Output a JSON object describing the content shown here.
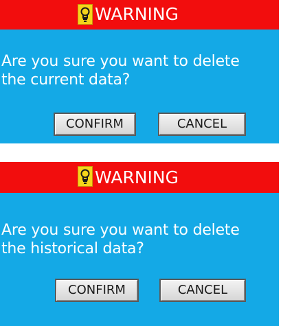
{
  "dialogs": [
    {
      "icon": "warning-bulb-icon",
      "title": "WARNING",
      "message": "Are you sure you want to delete\nthe current data?",
      "confirm_label": "CONFIRM",
      "cancel_label": "CANCEL"
    },
    {
      "icon": "warning-bulb-icon",
      "title": "WARNING",
      "message": "Are you sure you want to delete\nthe historical data?",
      "confirm_label": "CONFIRM",
      "cancel_label": "CANCEL"
    }
  ],
  "colors": {
    "title_bar": "#f20d0d",
    "dialog_background": "#14a9e6",
    "icon_background": "#f5d51a",
    "text": "#ffffff"
  }
}
